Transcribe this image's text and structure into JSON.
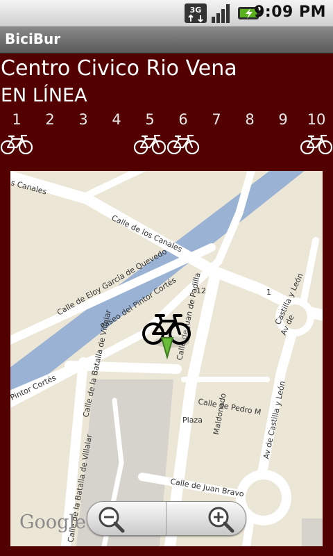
{
  "status_bar": {
    "network": "3G",
    "time": "9:09 PM"
  },
  "app": {
    "title": "BiciBur"
  },
  "station": {
    "name": "Centro Civico Rio Vena",
    "status": "EN LÍNEA"
  },
  "slots": [
    {
      "number": "1",
      "has_bike": true
    },
    {
      "number": "2",
      "has_bike": false
    },
    {
      "number": "3",
      "has_bike": false
    },
    {
      "number": "4",
      "has_bike": false
    },
    {
      "number": "5",
      "has_bike": true
    },
    {
      "number": "6",
      "has_bike": true
    },
    {
      "number": "7",
      "has_bike": false
    },
    {
      "number": "8",
      "has_bike": false
    },
    {
      "number": "9",
      "has_bike": false
    },
    {
      "number": "10",
      "has_bike": true
    }
  ],
  "map": {
    "streets": [
      "s Canales",
      "Calle de los Canales",
      "Calle de Eloy García de Quevedo",
      "Paseo del Pintor Cortés",
      "Calle de Juan de Padilla",
      "Castilla y León",
      "Av de",
      "Calle de la Batalla de Villalar",
      "Pintor Cortés",
      "Calle de Pedro M",
      "Plaza",
      "Maldonado",
      "Av de Castilla y León",
      "Calle de Juan Bravo",
      "Calle de la Batalla de Villalar",
      "12",
      "1"
    ],
    "provider": "Google"
  },
  "colors": {
    "background": "#520000",
    "map_road": "#ffffff",
    "map_water": "#9ab3d5",
    "map_land": "#ece6d6"
  }
}
